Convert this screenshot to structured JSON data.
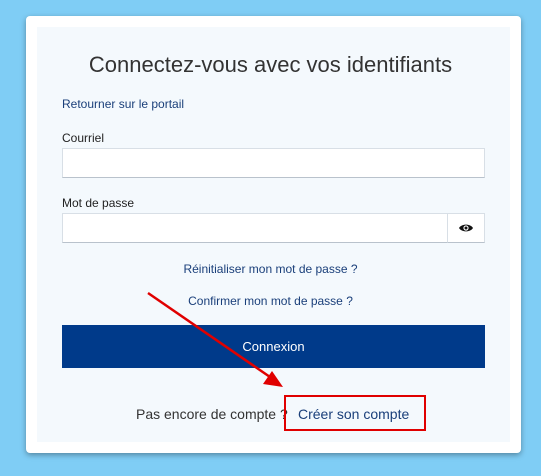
{
  "login": {
    "title": "Connectez-vous avec vos identifiants",
    "back_link": "Retourner sur le portail",
    "email_label": "Courriel",
    "email_value": "",
    "password_label": "Mot de passe",
    "password_value": "",
    "show_password_icon": "eye-icon",
    "reset_password_link": "Réinitialiser mon mot de passe ?",
    "confirm_password_link": "Confirmer mon mot de passe ?",
    "submit_label": "Connexion",
    "no_account_text": "Pas encore de compte ?",
    "create_account_link": "Créer son compte"
  },
  "colors": {
    "background": "#7fcdf5",
    "primary_button": "#003a8a",
    "link": "#1a3f7a",
    "annotation": "#e00000"
  }
}
